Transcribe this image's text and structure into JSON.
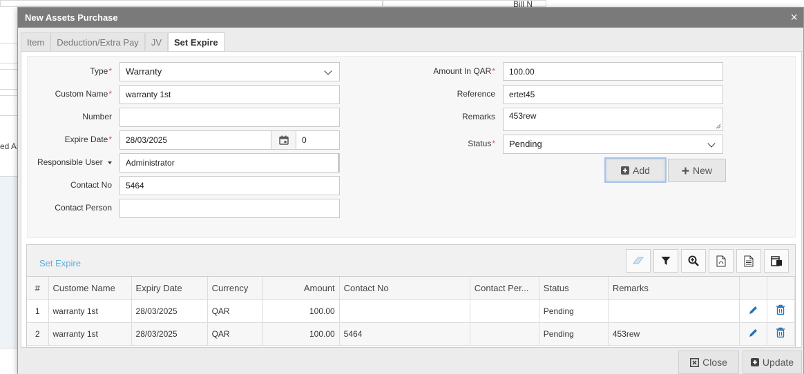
{
  "background": {
    "top_right_text": "Bill N",
    "left_text": "ed As"
  },
  "modal": {
    "title": "New Assets Purchase",
    "close_glyph": "×"
  },
  "tabs": [
    {
      "label": "Item"
    },
    {
      "label": "Deduction/Extra Pay"
    },
    {
      "label": "JV"
    },
    {
      "label": "Set Expire"
    }
  ],
  "form": {
    "type": {
      "label": "Type",
      "value": "Warranty"
    },
    "custom_name": {
      "label": "Custom Name",
      "value": "warranty 1st"
    },
    "number": {
      "label": "Number",
      "value": ""
    },
    "expire_date": {
      "label": "Expire Date",
      "value": "28/03/2025",
      "days": "0"
    },
    "responsible_user": {
      "label": "Responsible User",
      "value": "Administrator"
    },
    "contact_no": {
      "label": "Contact No",
      "value": "5464"
    },
    "contact_person": {
      "label": "Contact Person",
      "value": ""
    },
    "amount": {
      "label": "Amount In QAR",
      "value": "100.00"
    },
    "reference": {
      "label": "Reference",
      "value": "ertet45"
    },
    "remarks": {
      "label": "Remarks",
      "value": "453rew"
    },
    "status": {
      "label": "Status",
      "value": "Pending"
    },
    "required_mark": "*",
    "add_label": "Add",
    "new_label": "New"
  },
  "grid": {
    "title": "Set Expire",
    "columns": [
      "#",
      "Custome Name",
      "Expiry Date",
      "Currency",
      "Amount",
      "Contact No",
      "Contact Per...",
      "Status",
      "Remarks"
    ],
    "rows": [
      {
        "n": "1",
        "name": "warranty 1st",
        "date": "28/03/2025",
        "currency": "QAR",
        "amount": "100.00",
        "contact_no": "",
        "contact_person": "",
        "status": "Pending",
        "remarks": ""
      },
      {
        "n": "2",
        "name": "warranty 1st",
        "date": "28/03/2025",
        "currency": "QAR",
        "amount": "100.00",
        "contact_no": "5464",
        "contact_person": "",
        "status": "Pending",
        "remarks": "453rew"
      }
    ]
  },
  "footer": {
    "close_label": "Close",
    "update_label": "Update"
  },
  "colors": {
    "accent": "#5aaee0",
    "icon_blue": "#2a72b5",
    "required": "#d9534f"
  }
}
